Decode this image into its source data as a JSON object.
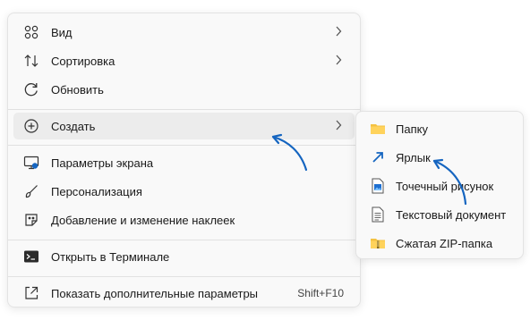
{
  "context_menu": {
    "items": [
      {
        "label": "Вид",
        "icon": "grid-icon"
      },
      {
        "label": "Сортировка",
        "icon": "sort-icon"
      },
      {
        "label": "Обновить",
        "icon": "refresh-icon"
      },
      {
        "label": "Создать",
        "icon": "plus-circle-icon"
      },
      {
        "label": "Параметры экрана",
        "icon": "display-icon"
      },
      {
        "label": "Персонализация",
        "icon": "brush-icon"
      },
      {
        "label": "Добавление и изменение наклеек",
        "icon": "sticker-icon"
      },
      {
        "label": "Открыть в Терминале",
        "icon": "terminal-icon"
      },
      {
        "label": "Показать дополнительные параметры",
        "icon": "more-options-icon",
        "shortcut": "Shift+F10"
      }
    ]
  },
  "submenu": {
    "items": [
      {
        "label": "Папку",
        "icon": "folder-icon"
      },
      {
        "label": "Ярлык",
        "icon": "shortcut-icon"
      },
      {
        "label": "Точечный рисунок",
        "icon": "bitmap-icon"
      },
      {
        "label": "Текстовый документ",
        "icon": "text-document-icon"
      },
      {
        "label": "Сжатая ZIP-папка",
        "icon": "zip-folder-icon"
      }
    ]
  },
  "colors": {
    "accent": "#1565c0",
    "menu_bg": "#f9f9f9",
    "hover_bg": "#ececec",
    "folder": "#f4c242"
  }
}
